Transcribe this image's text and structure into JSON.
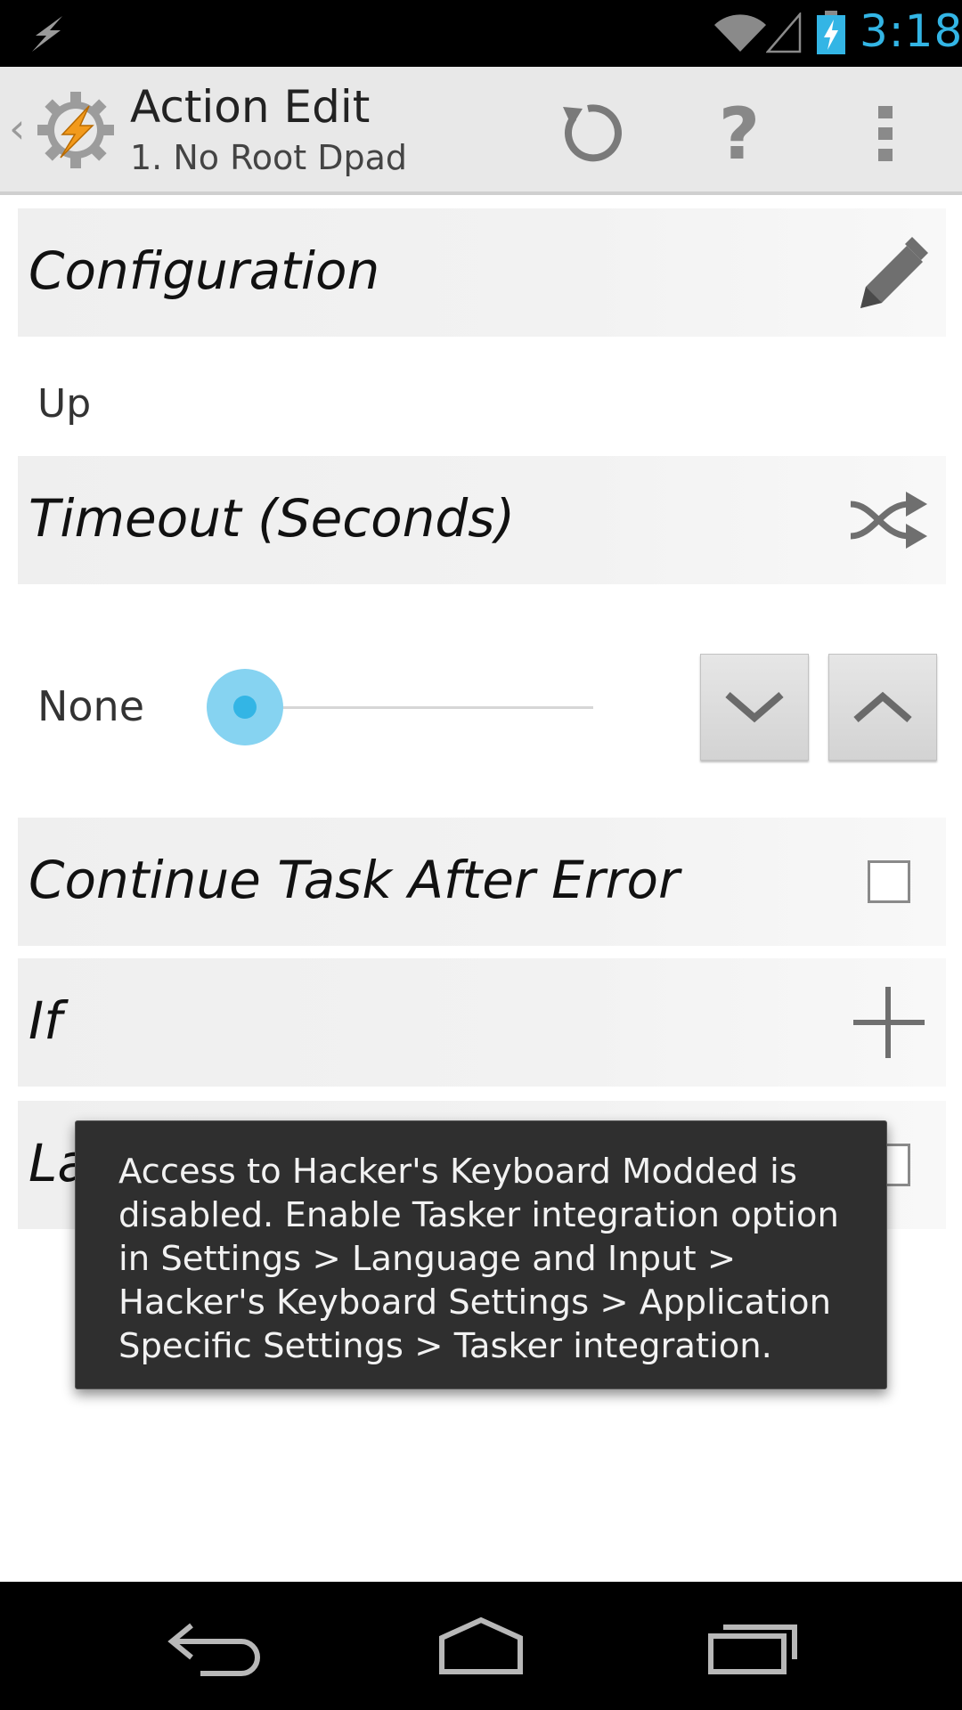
{
  "status_bar": {
    "time": "3:18",
    "notification_icon": "lightning-icon",
    "wifi_icon": "wifi-icon",
    "signal_icon": "signal-icon",
    "battery_icon": "battery-charging-icon",
    "accent_color": "#33b5e5"
  },
  "action_bar": {
    "title": "Action Edit",
    "subtitle": "1. No Root Dpad",
    "up_icon": "chevron-left-icon",
    "app_icon": "tasker-gear-icon",
    "help_label": "?",
    "actions": [
      "refresh-icon",
      "help-icon",
      "overflow-menu-icon"
    ]
  },
  "sections": {
    "configuration": {
      "label": "Configuration",
      "icon": "pencil-icon",
      "value": "Up"
    },
    "timeout": {
      "label": "Timeout (Seconds)",
      "icon": "shuffle-icon",
      "value_label": "None",
      "slider_fraction": 0.0
    },
    "continue_after_error": {
      "label": "Continue Task After Error",
      "checked": false
    },
    "if": {
      "label": "If",
      "icon": "plus-icon"
    },
    "label": {
      "label": "Label",
      "checked": false
    }
  },
  "toast": {
    "message": "Access to Hacker's Keyboard Modded is disabled. Enable Tasker integration option in Settings > Language and Input > Hacker's Keyboard Settings > Application Specific Settings > Tasker integration."
  },
  "nav_bar": {
    "buttons": [
      "back-icon",
      "home-icon",
      "recent-apps-icon"
    ]
  }
}
